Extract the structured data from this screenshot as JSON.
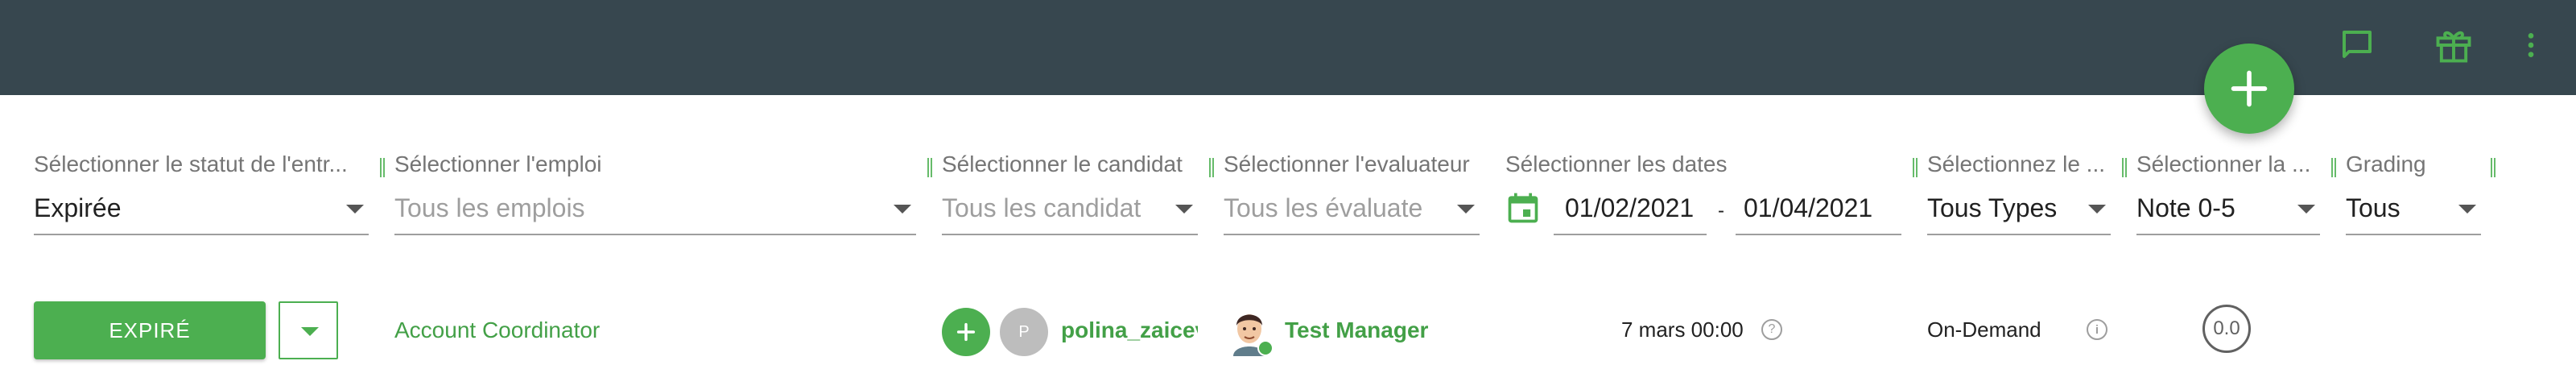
{
  "header": {
    "icons": [
      "chat-icon",
      "gift-icon",
      "more-vert-icon"
    ],
    "fab_icon": "plus-icon",
    "background": "#37474f",
    "accent": "#4caf50"
  },
  "filters": {
    "status": {
      "label": "Sélectionner le statut de l'entr...",
      "value": "Expirée"
    },
    "job": {
      "label": "Sélectionner l'emploi",
      "placeholder": "Tous les emplois"
    },
    "candidate": {
      "label": "Sélectionner le candidat",
      "placeholder": "Tous les candidat"
    },
    "evaluator": {
      "label": "Sélectionner l'evaluateur",
      "placeholder": "Tous les évaluate"
    },
    "dates": {
      "label": "Sélectionner les dates",
      "start": "01/02/2021",
      "separator": "-",
      "end": "01/04/2021"
    },
    "type": {
      "label": "Sélectionnez le ...",
      "value": "Tous Types"
    },
    "rating": {
      "label": "Sélectionner la ...",
      "value": "Note 0-5"
    },
    "grading": {
      "label": "Grading",
      "value": "Tous"
    }
  },
  "row": {
    "status_button": "EXPIRÉ",
    "job": "Account Coordinator",
    "candidate_initial": "P",
    "candidate_name": "polina_zaiceva",
    "evaluator": "Test Manager",
    "date": "7 mars 00:00",
    "type": "On-Demand",
    "score": "0.0"
  }
}
